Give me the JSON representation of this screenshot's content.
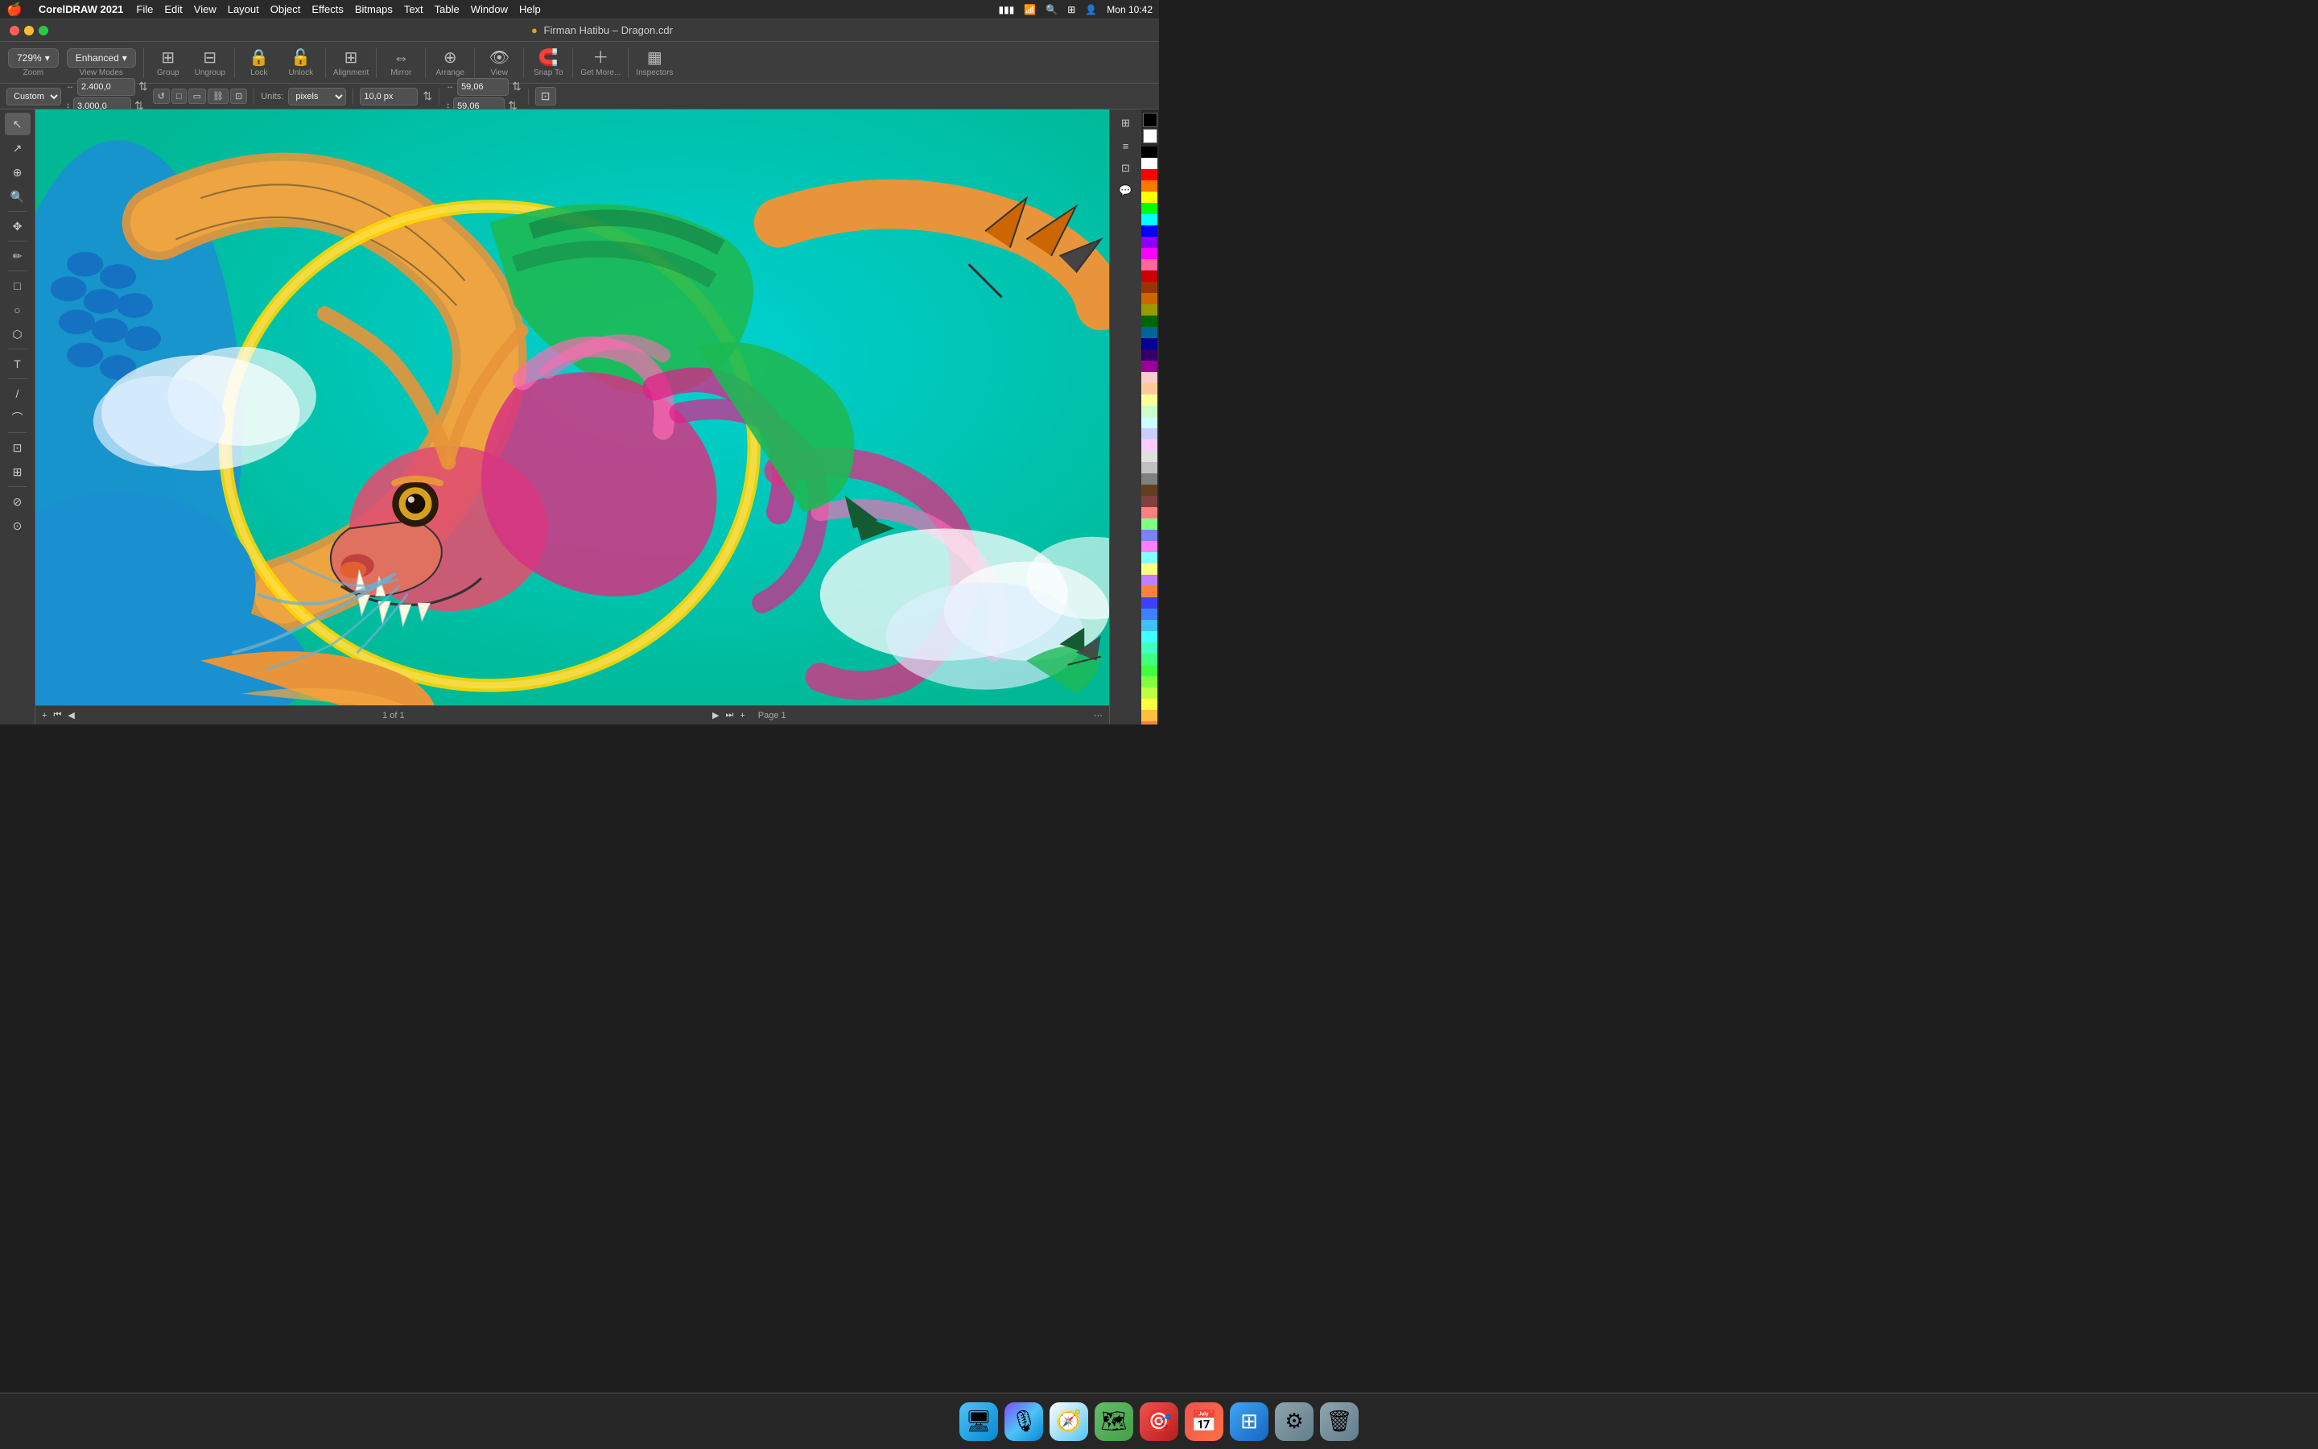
{
  "app": {
    "name": "CorelDRAW 2021",
    "title": "Firman Hatibu – Dragon.cdr",
    "title_icon": "●"
  },
  "menubar": {
    "apple": "🍎",
    "items": [
      "CorelDRAW 2021",
      "File",
      "Edit",
      "View",
      "Layout",
      "Object",
      "Effects",
      "Bitmaps",
      "Text",
      "Table",
      "Window",
      "Help"
    ],
    "right_icons": [
      "battery",
      "wifi",
      "search",
      "control",
      "user",
      "clock"
    ]
  },
  "toolbar": {
    "zoom_label": "729%",
    "view_mode_label": "Enhanced",
    "view_mode_arrow": "▾",
    "groups": [
      {
        "label": "Group",
        "icon": "⊞"
      },
      {
        "label": "Ungroup",
        "icon": "⊟"
      },
      {
        "label": "Lock",
        "icon": "🔒"
      },
      {
        "label": "Unlock",
        "icon": "🔓"
      },
      {
        "label": "Alignment",
        "icon": "⊞"
      },
      {
        "label": "Mirror",
        "icon": "⇔"
      },
      {
        "label": "Arrange",
        "icon": "⊕"
      },
      {
        "label": "View",
        "icon": "👁"
      },
      {
        "label": "Snap To",
        "icon": "⊞"
      },
      {
        "label": "Get More...",
        "icon": "＋"
      },
      {
        "label": "Inspectors",
        "icon": "▦"
      }
    ]
  },
  "property_bar": {
    "preset_label": "Custom",
    "width_value": "2.400,0",
    "height_value": "3.000,0",
    "units_label": "Units:",
    "units_value": "pixels",
    "nudge_value": "10,0 px",
    "x_value": "59,06",
    "y_value": "59,06",
    "shape_icon": "↺"
  },
  "left_tools": [
    {
      "name": "select-tool",
      "icon": "↖",
      "active": true
    },
    {
      "name": "freehand-tool",
      "icon": "↗"
    },
    {
      "name": "transform-tool",
      "icon": "⊕"
    },
    {
      "name": "zoom-tool",
      "icon": "🔍"
    },
    {
      "name": "pan-tool",
      "icon": "✥"
    },
    {
      "name": "freehand-draw",
      "icon": "✏"
    },
    {
      "name": "rect-tool",
      "icon": "□"
    },
    {
      "name": "ellipse-tool",
      "icon": "○"
    },
    {
      "name": "polygon-tool",
      "icon": "⬡"
    },
    {
      "name": "text-tool",
      "icon": "T"
    },
    {
      "name": "line-tool",
      "icon": "/"
    },
    {
      "name": "connector-tool",
      "icon": "⌒"
    },
    {
      "name": "shadow-tool",
      "icon": "□"
    },
    {
      "name": "mesh-tool",
      "icon": "⊞"
    },
    {
      "name": "eyedropper-tool",
      "icon": "⊘"
    },
    {
      "name": "fill-tool",
      "icon": "⊙"
    }
  ],
  "right_tools": [
    {
      "name": "transform-panel",
      "icon": "⊞"
    },
    {
      "name": "align-panel",
      "icon": "≡"
    },
    {
      "name": "copy-panel",
      "icon": "⊡"
    },
    {
      "name": "comment-panel",
      "icon": "💬"
    }
  ],
  "color_swatches": [
    "#000000",
    "#ffffff",
    "#ff0000",
    "#ff7700",
    "#ffff00",
    "#00ff00",
    "#00ffff",
    "#0000ff",
    "#8b00ff",
    "#ff00ff",
    "#ff6699",
    "#cc0000",
    "#993300",
    "#cc6600",
    "#999900",
    "#006600",
    "#006699",
    "#000099",
    "#330066",
    "#990099",
    "#ffcccc",
    "#ffcc99",
    "#ffff99",
    "#ccffcc",
    "#ccffff",
    "#ccccff",
    "#ffccff",
    "#e0e0e0",
    "#c0c0c0",
    "#808080",
    "#604020",
    "#804040",
    "#ff8080",
    "#80ff80",
    "#8080ff",
    "#ff80ff",
    "#80ffff",
    "#ffff80",
    "#c080ff",
    "#ff8040",
    "#4040ff",
    "#4080ff",
    "#40c0ff",
    "#40ffff",
    "#40ffc0",
    "#40ff80",
    "#40ff40",
    "#80ff40",
    "#c0ff40",
    "#ffff40",
    "#ffc040",
    "#ff8040",
    "#ff4040",
    "#ff4080",
    "#ff40c0"
  ],
  "status_bar": {
    "add_page": "+",
    "page_info": "1 of 1",
    "page_label": "Page 1",
    "nav_prev_start": "⏮",
    "nav_prev": "◀",
    "nav_next": "▶",
    "nav_next_end": "⏭",
    "add_end": "+",
    "more": "···"
  },
  "dock": {
    "items": [
      {
        "name": "finder",
        "icon": "🖥",
        "label": "Finder"
      },
      {
        "name": "siri",
        "icon": "🎙",
        "label": "Siri"
      },
      {
        "name": "safari",
        "icon": "🧭",
        "label": "Safari"
      },
      {
        "name": "maps",
        "icon": "🗺",
        "label": "Maps"
      },
      {
        "name": "robinhoodie",
        "icon": "🎯",
        "label": "App"
      },
      {
        "name": "fantastical",
        "icon": "📅",
        "label": "Fantastical"
      },
      {
        "name": "launchpad",
        "icon": "⊞",
        "label": "Launchpad"
      },
      {
        "name": "system-prefs",
        "icon": "⚙",
        "label": "System Preferences"
      },
      {
        "name": "trash",
        "icon": "🗑",
        "label": "Trash"
      }
    ]
  }
}
